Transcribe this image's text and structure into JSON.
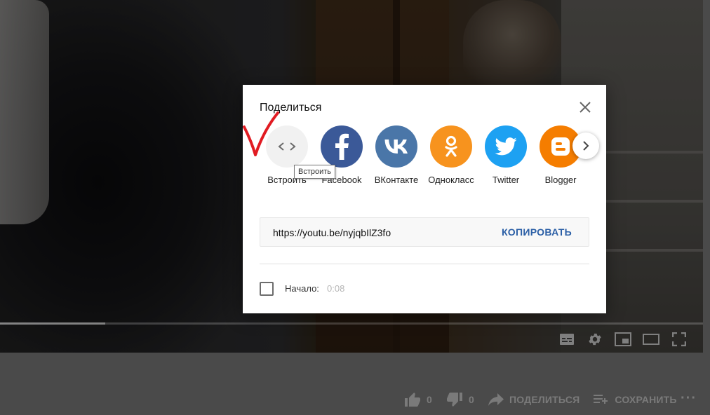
{
  "dialog": {
    "title": "Поделиться",
    "close_icon": "close-icon",
    "share_targets": [
      {
        "label": "Встроить",
        "icon": "embed-code-icon",
        "color": "#f1f1f1"
      },
      {
        "label": "Facebook",
        "icon": "facebook-icon",
        "color": "#3b5998"
      },
      {
        "label": "ВКонтакте",
        "icon": "vk-icon",
        "color": "#4a76a8"
      },
      {
        "label": "Однокласс",
        "icon": "odnoklassniki-icon",
        "color": "#f7931e"
      },
      {
        "label": "Twitter",
        "icon": "twitter-icon",
        "color": "#1da1f2"
      },
      {
        "label": "Blogger",
        "icon": "blogger-icon",
        "color": "#f57d00"
      }
    ],
    "tooltip": "Встроить",
    "url": "https://youtu.be/nyjqbIlZ3fo",
    "copy_label": "КОПИРОВАТЬ",
    "start_label": "Начало:",
    "start_time": "0:08"
  },
  "player": {
    "progress": 0.15,
    "controls": [
      "subtitles-icon",
      "settings-gear-icon",
      "miniplayer-icon",
      "theater-mode-icon",
      "fullscreen-icon"
    ]
  },
  "actions": {
    "like_count": "0",
    "dislike_count": "0",
    "share_label": "ПОДЕЛИТЬСЯ",
    "save_label": "СОХРАНИТЬ"
  },
  "colors": {
    "accent_link": "#2b5fa6",
    "annotation_red": "#e11b22"
  }
}
